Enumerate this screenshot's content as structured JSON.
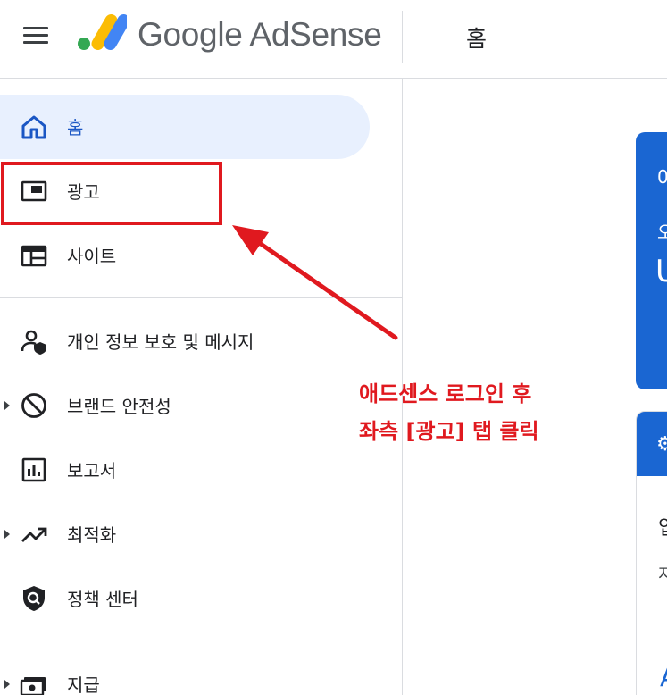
{
  "header": {
    "brand": "Google AdSense",
    "page_title": "홈"
  },
  "sidebar": {
    "items": [
      {
        "label": "홈",
        "icon": "home-icon"
      },
      {
        "label": "광고",
        "icon": "ads-icon"
      },
      {
        "label": "사이트",
        "icon": "sites-icon"
      },
      {
        "label": "개인 정보 보호 및 메시지",
        "icon": "privacy-icon"
      },
      {
        "label": "브랜드 안전성",
        "icon": "block-icon"
      },
      {
        "label": "보고서",
        "icon": "reports-icon"
      },
      {
        "label": "최적화",
        "icon": "trending-up-icon"
      },
      {
        "label": "정책 센터",
        "icon": "policy-shield-icon"
      },
      {
        "label": "지급",
        "icon": "payments-icon"
      }
    ]
  },
  "annotation": {
    "line1": "애드센스 로그인 후",
    "line2": "좌측 [광고] 탭 클릭"
  },
  "content": {
    "card1": {
      "t1": "0",
      "t2": "오",
      "t3": "U"
    },
    "card2": {
      "t1": "입",
      "t2": "지",
      "t3": "A"
    }
  },
  "colors": {
    "accent": "#1a66d2",
    "active_bg": "#e8f0fe",
    "annotation": "#e0191f"
  }
}
